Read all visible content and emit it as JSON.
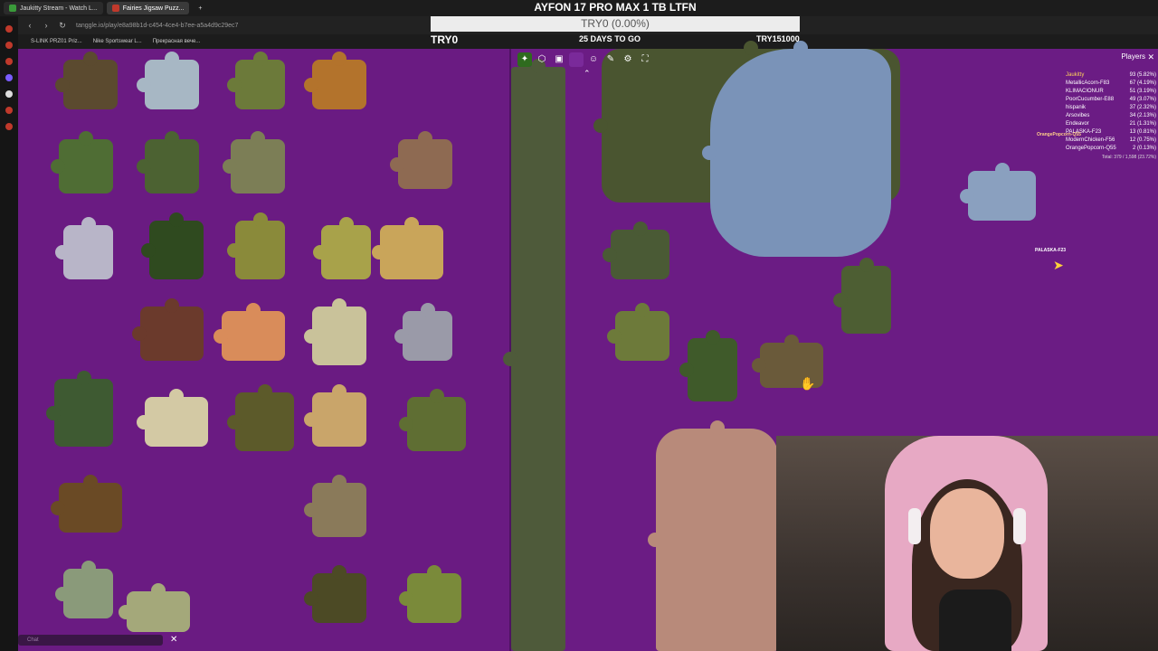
{
  "browser": {
    "tabs": [
      {
        "label": "Jaukitty Stream - Watch L...",
        "active": false,
        "color": "#3a9a3a"
      },
      {
        "label": "Fairies Jigsaw Puzz...",
        "active": true,
        "color": "#c0392b"
      }
    ],
    "new_tab": "+",
    "url": "tanggle.io/play/e8a98b1d-c454-4ce4-b7ee-a5a4d9c29ec7",
    "bookmarks": [
      "S-LINK PRZ01 Priz...",
      "Nike Sportswear L...",
      "Прекрасная вече..."
    ]
  },
  "stream_overlay": {
    "title": "AYFON 17 PRO MAX 1 TB LTFN",
    "progress_text": "TRY0 (0.00%)",
    "progress_fraction": 0.0,
    "left_label": "TRY0",
    "middle_label": "25 DAYS TO GO",
    "right_label": "TRY151000"
  },
  "puzzle": {
    "board_color": "#6a1b82",
    "toolbar_icons": [
      "puzzle-piece-icon",
      "box-icon",
      "image-icon",
      "color-swatch-icon",
      "players-icon",
      "pen-icon",
      "gear-icon",
      "fullscreen-icon"
    ],
    "collapse_icon": "chevron-up-icon",
    "players_panel": {
      "title": "Players",
      "close": "✕",
      "rows": [
        {
          "name": "Jaukitty",
          "score": "93 (5.82%)"
        },
        {
          "name": "MetallicAcorn-F83",
          "score": "67 (4.19%)"
        },
        {
          "name": "KLIMACIONUR",
          "score": "51 (3.19%)"
        },
        {
          "name": "PoorCucumber-E88",
          "score": "49 (3.07%)"
        },
        {
          "name": "hispanik",
          "score": "37 (2.32%)"
        },
        {
          "name": "Arsovibes",
          "score": "34 (2.13%)"
        },
        {
          "name": "Endeavor",
          "score": "21 (1.31%)"
        },
        {
          "name": "PALASKA-F23",
          "score": "13 (0.81%)"
        },
        {
          "name": "ModernChicken-F56",
          "score": "12 (0.75%)"
        },
        {
          "name": "OrangePopcorn-Q55",
          "score": "2 (0.13%)"
        }
      ],
      "total": "Total: 379 / 1,598 (23.72%)"
    },
    "cursor_labels": [
      "PALASKA-F23",
      "OrangePopcorn-Q55"
    ]
  },
  "chat": {
    "placeholder": "Chat",
    "close": "✕"
  }
}
